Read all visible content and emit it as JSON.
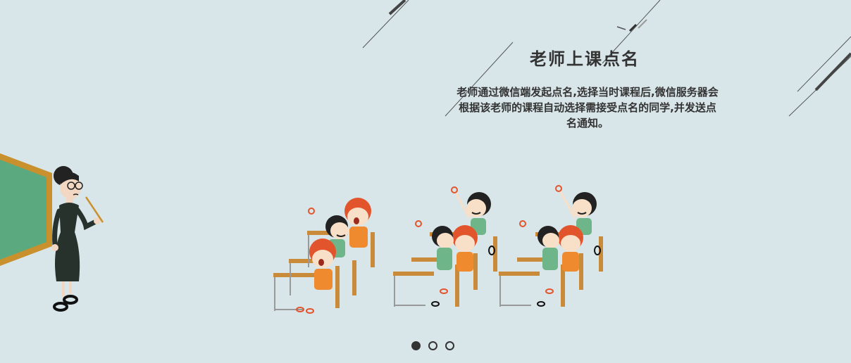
{
  "slide": {
    "title": "老师上课点名",
    "description": "老师通过微信端发起点名,选择当时课程后,微信服务器会根据该老师的课程自动选择需接受点名的同学,并发送点名通知。"
  },
  "pager": {
    "dots": [
      {
        "active": true
      },
      {
        "active": false
      },
      {
        "active": false
      }
    ]
  },
  "colors": {
    "background": "#d9e6e9",
    "text": "#333333",
    "board": "#5aa97f",
    "board_frame": "#c9902e",
    "desk": "#c98a3a",
    "shirt_green": "#6fb58a",
    "shirt_orange": "#f08a2e",
    "hair_red": "#e2552c"
  }
}
